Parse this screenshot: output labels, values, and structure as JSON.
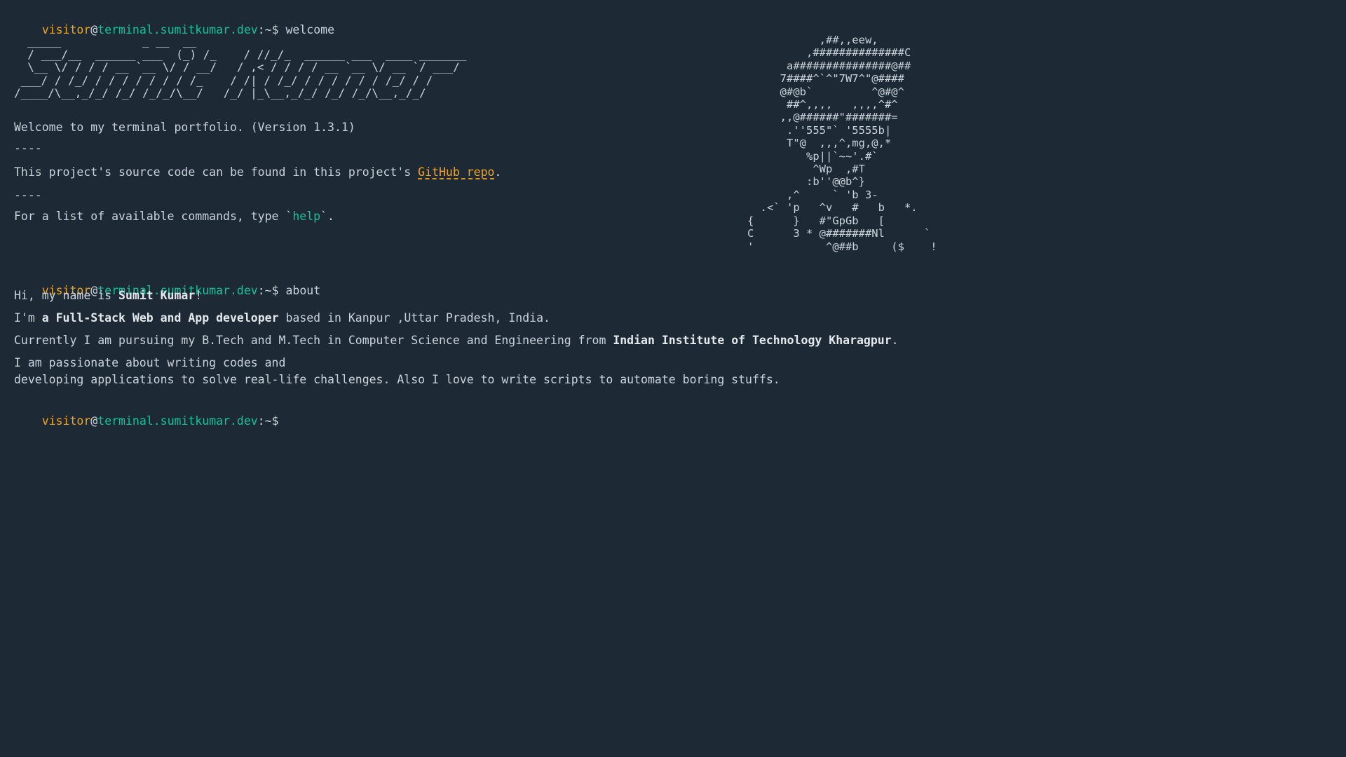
{
  "prompt": {
    "user": "visitor",
    "at": "@",
    "host": "terminal.sumitkumar.dev",
    "path": ":~$"
  },
  "session": {
    "cmd1": "welcome",
    "cmd2": "about",
    "cmd3": ""
  },
  "welcome": {
    "banner": "  _____            _ __  __                            \n  / ___/__  ______ ___  (_) /_    / //_/_  ______ ___  ____ _______\n  \\__ \\/ / / / __ `__ \\/ / __/   / ,< / / / / __ `__ \\/ __ `/ ___/\n ___/ / /_/ / / / / / / / /_    / /| / /_/ / / / / / / /_/ / /    \n/____/\\__,_/_/ /_/ /_/_/\\__/   /_/ |_\\__,_/_/ /_/ /_/\\__,_/_/     ",
    "ascii_art": "           ,##,,eew,\n         ,##############C\n      a###############@##\n     7####^`^\"7W7^\"@####\n     @#@b`         ^@#@^\n      ##^,,,,   ,,,,^#^\n     ,,@######\"#######=\n      .''555\"` '5555b|\n      T\"@  ,,,^,mg,@,*\n         %p||`~~'.#`\n          ^Wp  ,#T\n         :b''@@b^}\n      ,^     ` 'b 3-\n  .<` 'p   ^v   #   b   *.\n{      }   #\"GpGb   [\nC      3 * @#######Nl      `\n'           ^@##b     ($    !",
    "intro_line": "Welcome to my terminal portfolio. (Version 1.3.1)",
    "separator": "----",
    "source_prefix": "This project's source code can be found in this project's ",
    "source_link": "GitHub repo",
    "source_suffix": ".",
    "help_prefix": "For a list of available commands, type `",
    "help_command": "help",
    "help_suffix": "`."
  },
  "about": {
    "line1_prefix": "Hi, my name is ",
    "line1_name": "Sumit Kumar",
    "line1_suffix": "!",
    "line2_prefix": "I'm ",
    "line2_role": "a Full-Stack Web and App developer",
    "line2_suffix": " based in Kanpur ,Uttar Pradesh, India.",
    "line3_prefix": "Currently I am pursuing my B.Tech and M.Tech in Computer Science and Engineering from ",
    "line3_institute": "Indian Institute of Technology Kharagpur",
    "line3_suffix": ".",
    "line4": "I am passionate about writing codes and",
    "line5": "developing applications to solve real-life challenges. Also I love to write scripts to automate boring stuffs."
  },
  "colors": {
    "background": "#1d2a35",
    "text": "#cbd3da",
    "user": "#f5a41a",
    "host": "#13c39b",
    "link": "#f5a41a"
  }
}
